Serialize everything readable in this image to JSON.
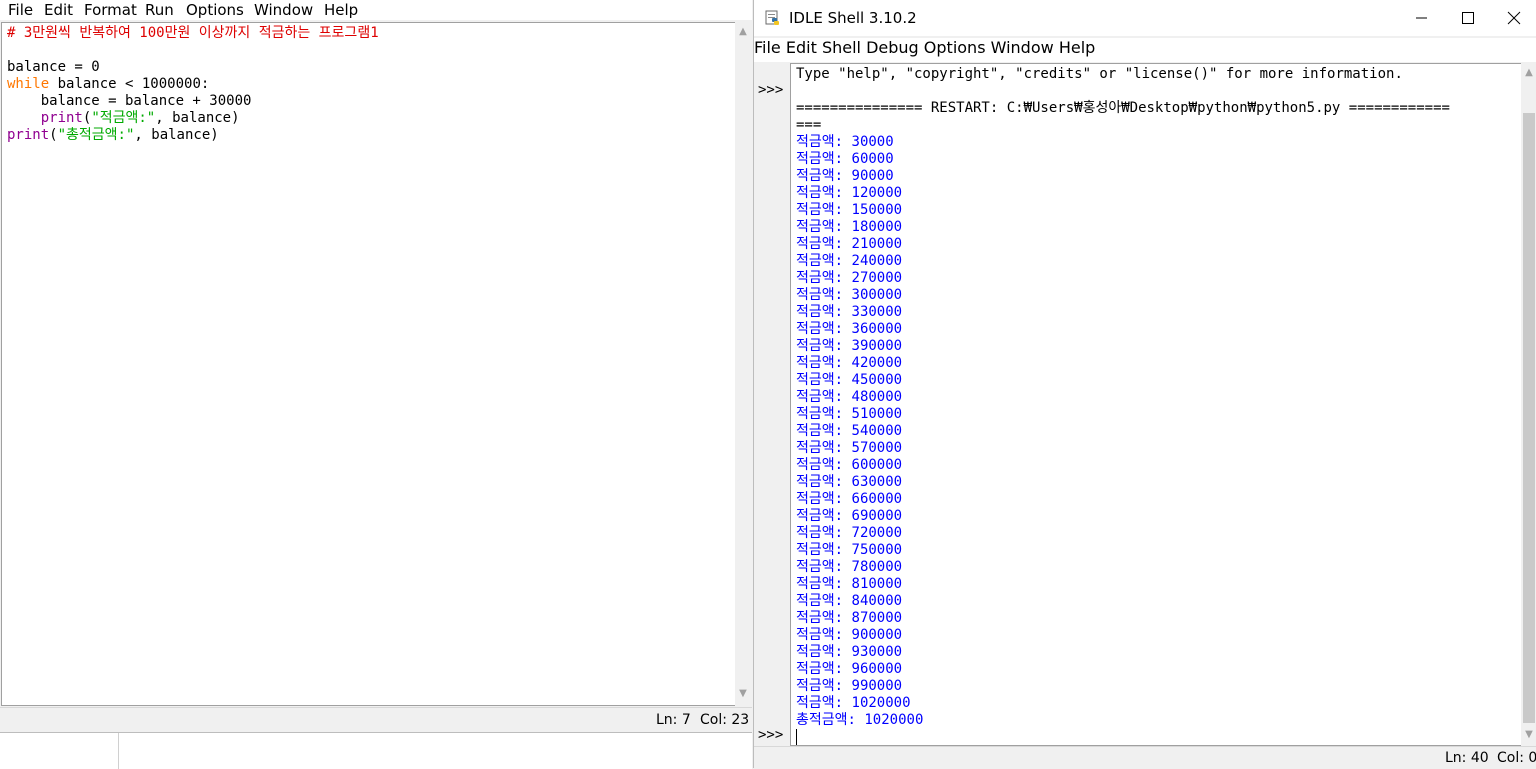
{
  "editor": {
    "menu": [
      "File",
      "Edit",
      "Format",
      "Run",
      "Options",
      "Window",
      "Help"
    ],
    "code": {
      "line1_comment": "# 3만원씩 반복하여 100만원 이상까지 적금하는 프로그램1",
      "line3": "balance = 0",
      "line4_kw": "while",
      "line4_rest": " balance < 1000000:",
      "line5": "    balance = balance + 30000",
      "line6_indent": "    ",
      "line6_fn": "print",
      "line6_open": "(",
      "line6_str": "\"적금액:\"",
      "line6_rest": ", balance)",
      "line7_fn": "print",
      "line7_open": "(",
      "line7_str": "\"총적금액:\"",
      "line7_rest": ", balance)"
    },
    "status": {
      "line": "Ln: 7",
      "col": "Col: 23"
    }
  },
  "shell": {
    "title": "IDLE Shell 3.10.2",
    "menu": [
      "File",
      "Edit",
      "Shell",
      "Debug",
      "Options",
      "Window",
      "Help"
    ],
    "prompt": ">>>",
    "info_line": "Type \"help\", \"copyright\", \"credits\" or \"license()\" for more information.",
    "restart_line": "=============== RESTART: C:₩Users₩홍성아₩Desktop₩python₩python5.py ============",
    "restart_cont": "===",
    "output_label": "적금액:",
    "output_values": [
      "30000",
      "60000",
      "90000",
      "120000",
      "150000",
      "180000",
      "210000",
      "240000",
      "270000",
      "300000",
      "330000",
      "360000",
      "390000",
      "420000",
      "450000",
      "480000",
      "510000",
      "540000",
      "570000",
      "600000",
      "630000",
      "660000",
      "690000",
      "720000",
      "750000",
      "780000",
      "810000",
      "840000",
      "870000",
      "900000",
      "930000",
      "960000",
      "990000",
      "1020000"
    ],
    "total_line": "총적금액: 1020000",
    "status": {
      "line": "Ln: 40",
      "col": "Col: 0"
    }
  }
}
